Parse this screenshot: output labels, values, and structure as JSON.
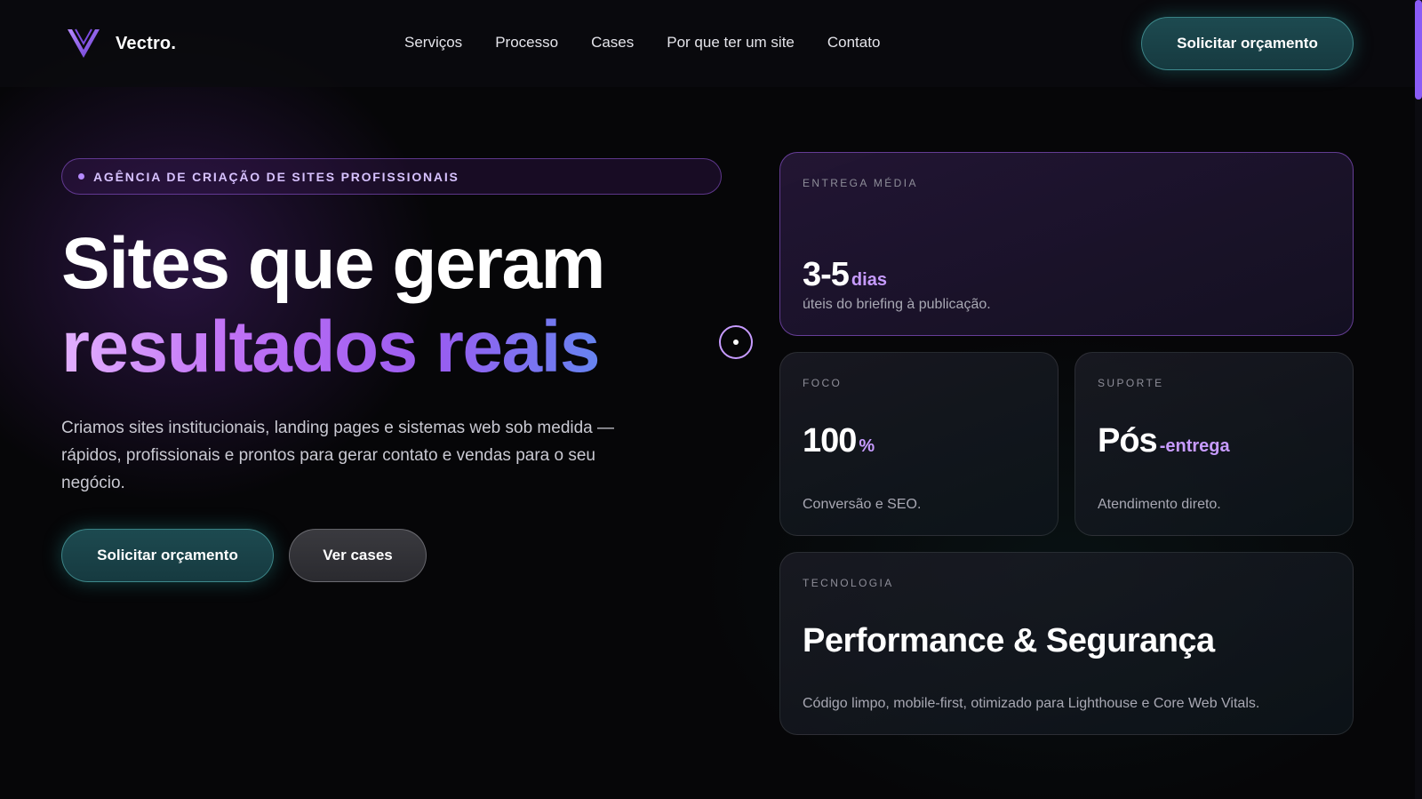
{
  "brand": {
    "name": "Vectro.",
    "logo_icon": "v-chevron-logo",
    "accent_color": "#8b5cf6",
    "teal_color": "#1d4a50"
  },
  "nav": {
    "items": [
      {
        "label": "Serviços"
      },
      {
        "label": "Processo"
      },
      {
        "label": "Cases"
      },
      {
        "label": "Por que ter um site"
      },
      {
        "label": "Contato"
      }
    ],
    "cta_label": "Solicitar orçamento"
  },
  "hero": {
    "badge": "AGÊNCIA DE CRIAÇÃO DE SITES PROFISSIONAIS",
    "headline_line1": "Sites que geram",
    "headline_line2": "resultados reais",
    "description": "Criamos sites institucionais, landing pages e sistemas web sob medida — rápidos, profissionais e prontos para gerar contato e vendas para o seu negócio.",
    "primary_button": "Solicitar orçamento",
    "secondary_button": "Ver cases"
  },
  "cards": {
    "delivery": {
      "label": "ENTREGA MÉDIA",
      "value": "3-5",
      "unit": "dias",
      "description": "úteis do briefing à publicação."
    },
    "focus": {
      "label": "FOCO",
      "value": "100",
      "unit": "%",
      "description": "Conversão e SEO."
    },
    "support": {
      "label": "SUPORTE",
      "value": "Pós",
      "unit": "-entrega",
      "description": "Atendimento direto."
    },
    "tech": {
      "label": "TECNOLOGIA",
      "title": "Performance & Segurança",
      "description": "Código limpo, mobile-first, otimizado para Lighthouse e Core Web Vitals."
    }
  }
}
